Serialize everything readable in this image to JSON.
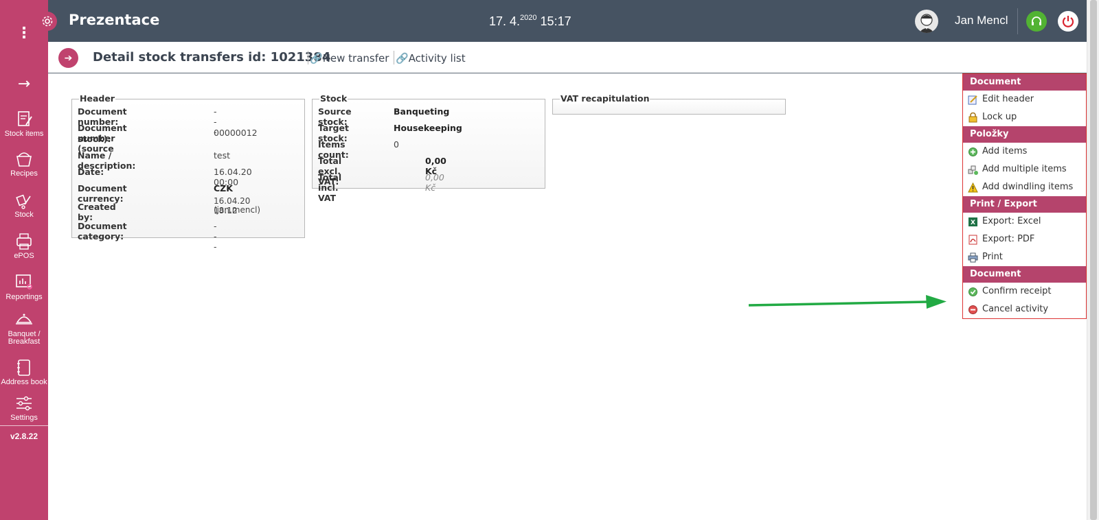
{
  "app": {
    "title": "Prezentace",
    "date_main": "17. 4.",
    "date_year": "2020",
    "time": "15:17",
    "user": "Jan Mencl",
    "version": "v2.8.22"
  },
  "sidebar": {
    "items": [
      {
        "label": "Stock items",
        "icon": "stock-items-icon"
      },
      {
        "label": "Recipes",
        "icon": "recipes-icon"
      },
      {
        "label": "Stock",
        "icon": "stock-icon"
      },
      {
        "label": "ePOS",
        "icon": "epos-icon"
      },
      {
        "label": "Reportings",
        "icon": "reportings-icon"
      },
      {
        "label": "Banquet / Breakfast",
        "icon": "banquet-icon"
      },
      {
        "label": "Address book",
        "icon": "address-book-icon"
      },
      {
        "label": "Settings",
        "icon": "settings-sliders-icon"
      }
    ]
  },
  "page": {
    "title": "Detail stock transfers id: 1021384",
    "links": [
      "New transfer",
      "Activity list"
    ]
  },
  "header_box": {
    "legend": "Header",
    "rows": [
      {
        "k": "Document number:",
        "v": "---"
      },
      {
        "k": "Document number (source",
        "k2": "stock):",
        "v": "00000012"
      },
      {
        "k": "Name / description:",
        "v": "test"
      },
      {
        "k": "Date:",
        "v": "16.04.20 00:00"
      },
      {
        "k": "Document currency:",
        "v": "CZK"
      },
      {
        "k": "Created by:",
        "v": "16.04.20 18:12",
        "v2": "(jan.mencl)"
      },
      {
        "k": "Document category:",
        "v": "---"
      }
    ]
  },
  "stock_box": {
    "legend": "Stock",
    "rows": [
      {
        "k": "Source stock:",
        "v": "Banqueting"
      },
      {
        "k": "Target stock:",
        "v": "Housekeeping"
      },
      {
        "k": "Items count:",
        "v": "0"
      },
      {
        "k": "Total excl. VAT:",
        "v": "0,00 Kč"
      },
      {
        "k": "Total incl. VAT",
        "v": "0,00 Kč"
      }
    ]
  },
  "vat_box": {
    "legend": "VAT recapitulation"
  },
  "actions": {
    "sections": [
      {
        "title": "Document",
        "items": [
          "Edit header",
          "Lock up"
        ]
      },
      {
        "title": "Položky",
        "items": [
          "Add items",
          "Add multiple items",
          "Add dwindling items"
        ]
      },
      {
        "title": "Print / Export",
        "items": [
          "Export: Excel",
          "Export: PDF",
          "Print"
        ]
      },
      {
        "title": "Document",
        "items": [
          "Confirm receipt",
          "Cancel activity"
        ]
      }
    ]
  },
  "colors": {
    "brand": "#c0426e",
    "topbar": "#465362",
    "section": "#b5446c",
    "annotation_arrow": "#22aa44"
  }
}
